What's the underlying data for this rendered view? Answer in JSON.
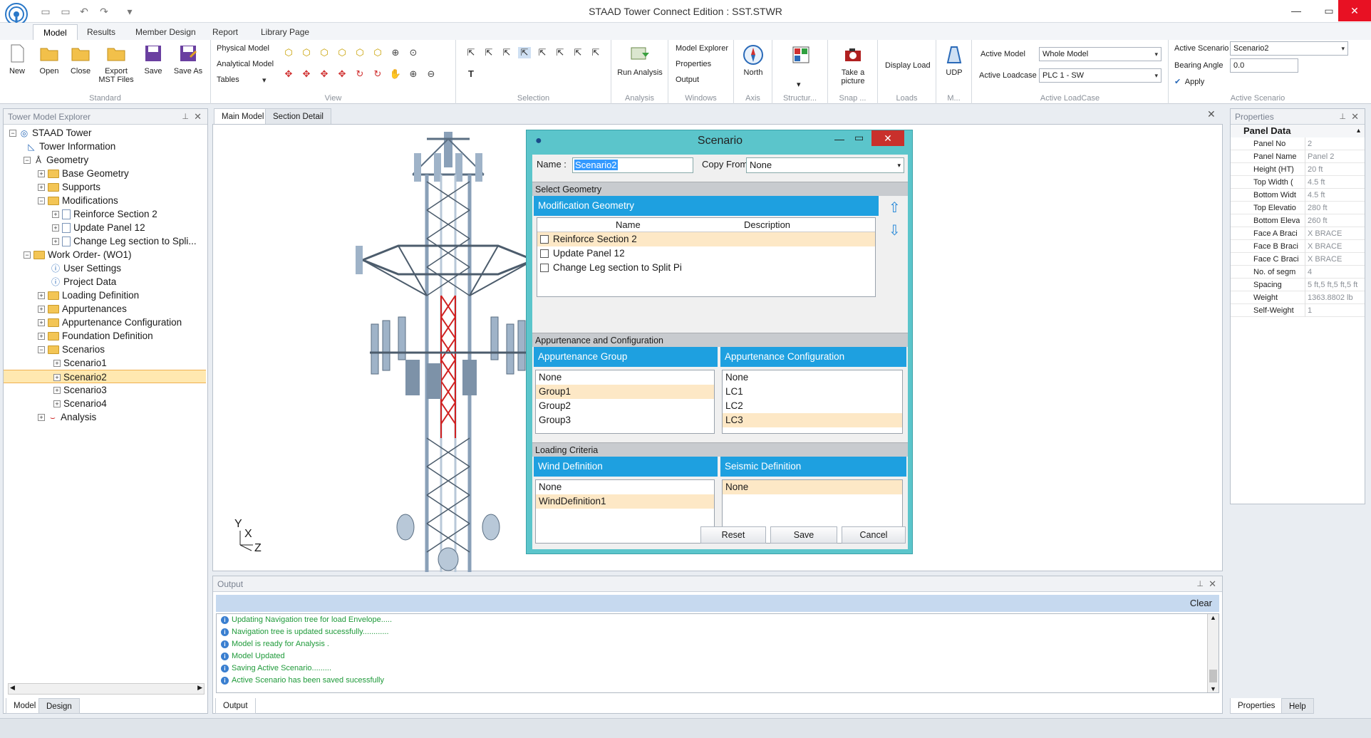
{
  "window": {
    "title": "STAAD Tower Connect Edition : SST.STWR"
  },
  "ribbon_tabs": [
    "Model",
    "Results",
    "Member Design",
    "Report",
    "Library Page"
  ],
  "standard": {
    "label": "Standard",
    "buttons": [
      "New",
      "Open",
      "Close",
      "Export",
      "MST Files",
      "Save",
      "Save As"
    ]
  },
  "view": {
    "label": "View",
    "items": [
      "Physical Model",
      "Analytical Model",
      "Tables"
    ]
  },
  "selection": {
    "label": "Selection"
  },
  "analysis": {
    "label": "Analysis",
    "run": "Run Analysis"
  },
  "windows": {
    "label": "Windows",
    "items": [
      "Model Explorer",
      "Properties",
      "Output"
    ]
  },
  "axis": {
    "label": "Axis",
    "north": "North"
  },
  "structure": {
    "label": "Structur..."
  },
  "snap": {
    "label": "Snap ...",
    "btn1": "Take a",
    "btn2": "picture"
  },
  "loads": {
    "label": "Loads",
    "btn": "Display Load"
  },
  "m": {
    "label": "M...",
    "btn": "UDP"
  },
  "active_load": {
    "label": "Active LoadCase",
    "model_label": "Active Model",
    "model_value": "Whole Model",
    "loadcase_label": "Active Loadcase",
    "loadcase_value": "PLC 1 - SW"
  },
  "active_scenario": {
    "label": "Active Scenario",
    "scenario_label": "Active Scenario",
    "scenario_value": "Scenario2",
    "bearing_label": "Bearing Angle",
    "bearing_value": "0.0",
    "apply": "Apply"
  },
  "explorer": {
    "title": "Tower Model Explorer",
    "tree": [
      "STAAD Tower",
      "Tower Information",
      "Geometry",
      "Base Geometry",
      "Supports",
      "Modifications",
      "Reinforce Section 2",
      "Update Panel 12",
      "Change Leg section to Spli...",
      "Work Order- (WO1)",
      "User Settings",
      "Project Data",
      "Loading Definition",
      "Appurtenances",
      "Appurtenance Configuration",
      "Foundation Definition",
      "Scenarios",
      "Scenario1",
      "Scenario2",
      "Scenario3",
      "Scenario4",
      "Analysis"
    ],
    "tabs": [
      "Model",
      "Design"
    ]
  },
  "doc_tabs": [
    "Main Model",
    "Section Detail"
  ],
  "axes_labels": {
    "y": "Y",
    "x": "X",
    "z": "Z"
  },
  "dialog": {
    "title": "Scenario",
    "name_label": "Name :",
    "name_value": "Scenario2",
    "copy_label": "Copy From :",
    "copy_value": "None",
    "select_geometry": "Select Geometry",
    "mod_geometry": "Modification Geometry",
    "col_name": "Name",
    "col_desc": "Description",
    "mods": [
      "Reinforce Section 2",
      "Update Panel 12",
      "Change Leg section to Split Pi"
    ],
    "app_section": "Appurtenance and Configuration",
    "app_group_hdr": "Appurtenance Group",
    "app_cfg_hdr": "Appurtenance Configuration",
    "app_groups": [
      "None",
      "Group1",
      "Group2",
      "Group3"
    ],
    "app_cfgs": [
      "None",
      "LC1",
      "LC2",
      "LC3"
    ],
    "loading_criteria": "Loading Criteria",
    "wind_hdr": "Wind Definition",
    "seismic_hdr": "Seismic Definition",
    "wind": [
      "None",
      "WindDefinition1"
    ],
    "seismic": [
      "None"
    ],
    "reset": "Reset",
    "save": "Save",
    "cancel": "Cancel"
  },
  "properties": {
    "title": "Properties",
    "section": "Panel Data",
    "rows": [
      {
        "k": "Panel No",
        "v": "2"
      },
      {
        "k": "Panel Name",
        "v": "Panel 2"
      },
      {
        "k": "Height (HT)",
        "v": "20 ft"
      },
      {
        "k": "Top Width (",
        "v": "4.5 ft"
      },
      {
        "k": "Bottom Widt",
        "v": "4.5 ft"
      },
      {
        "k": "Top Elevatio",
        "v": "280 ft"
      },
      {
        "k": "Bottom Eleva",
        "v": "260 ft"
      },
      {
        "k": "Face A Braci",
        "v": "X BRACE"
      },
      {
        "k": "Face B Braci",
        "v": "X BRACE"
      },
      {
        "k": "Face C Braci",
        "v": "X BRACE"
      },
      {
        "k": "No. of segm",
        "v": "4"
      },
      {
        "k": "Spacing",
        "v": "5 ft,5 ft,5 ft,5 ft"
      },
      {
        "k": "Weight",
        "v": "1363.8802 lb"
      },
      {
        "k": "Self-Weight",
        "v": "1"
      }
    ],
    "tabs": [
      "Properties",
      "Help"
    ]
  },
  "output": {
    "title": "Output",
    "clear": "Clear",
    "lines": [
      "Updating Navigation tree for load Envelope.....",
      "Navigation tree is updated sucessfully............",
      "Model is ready for Analysis .",
      "Model Updated",
      "Saving Active Scenario.........",
      "Active Scenario has been saved sucessfully"
    ],
    "tab": "Output"
  }
}
